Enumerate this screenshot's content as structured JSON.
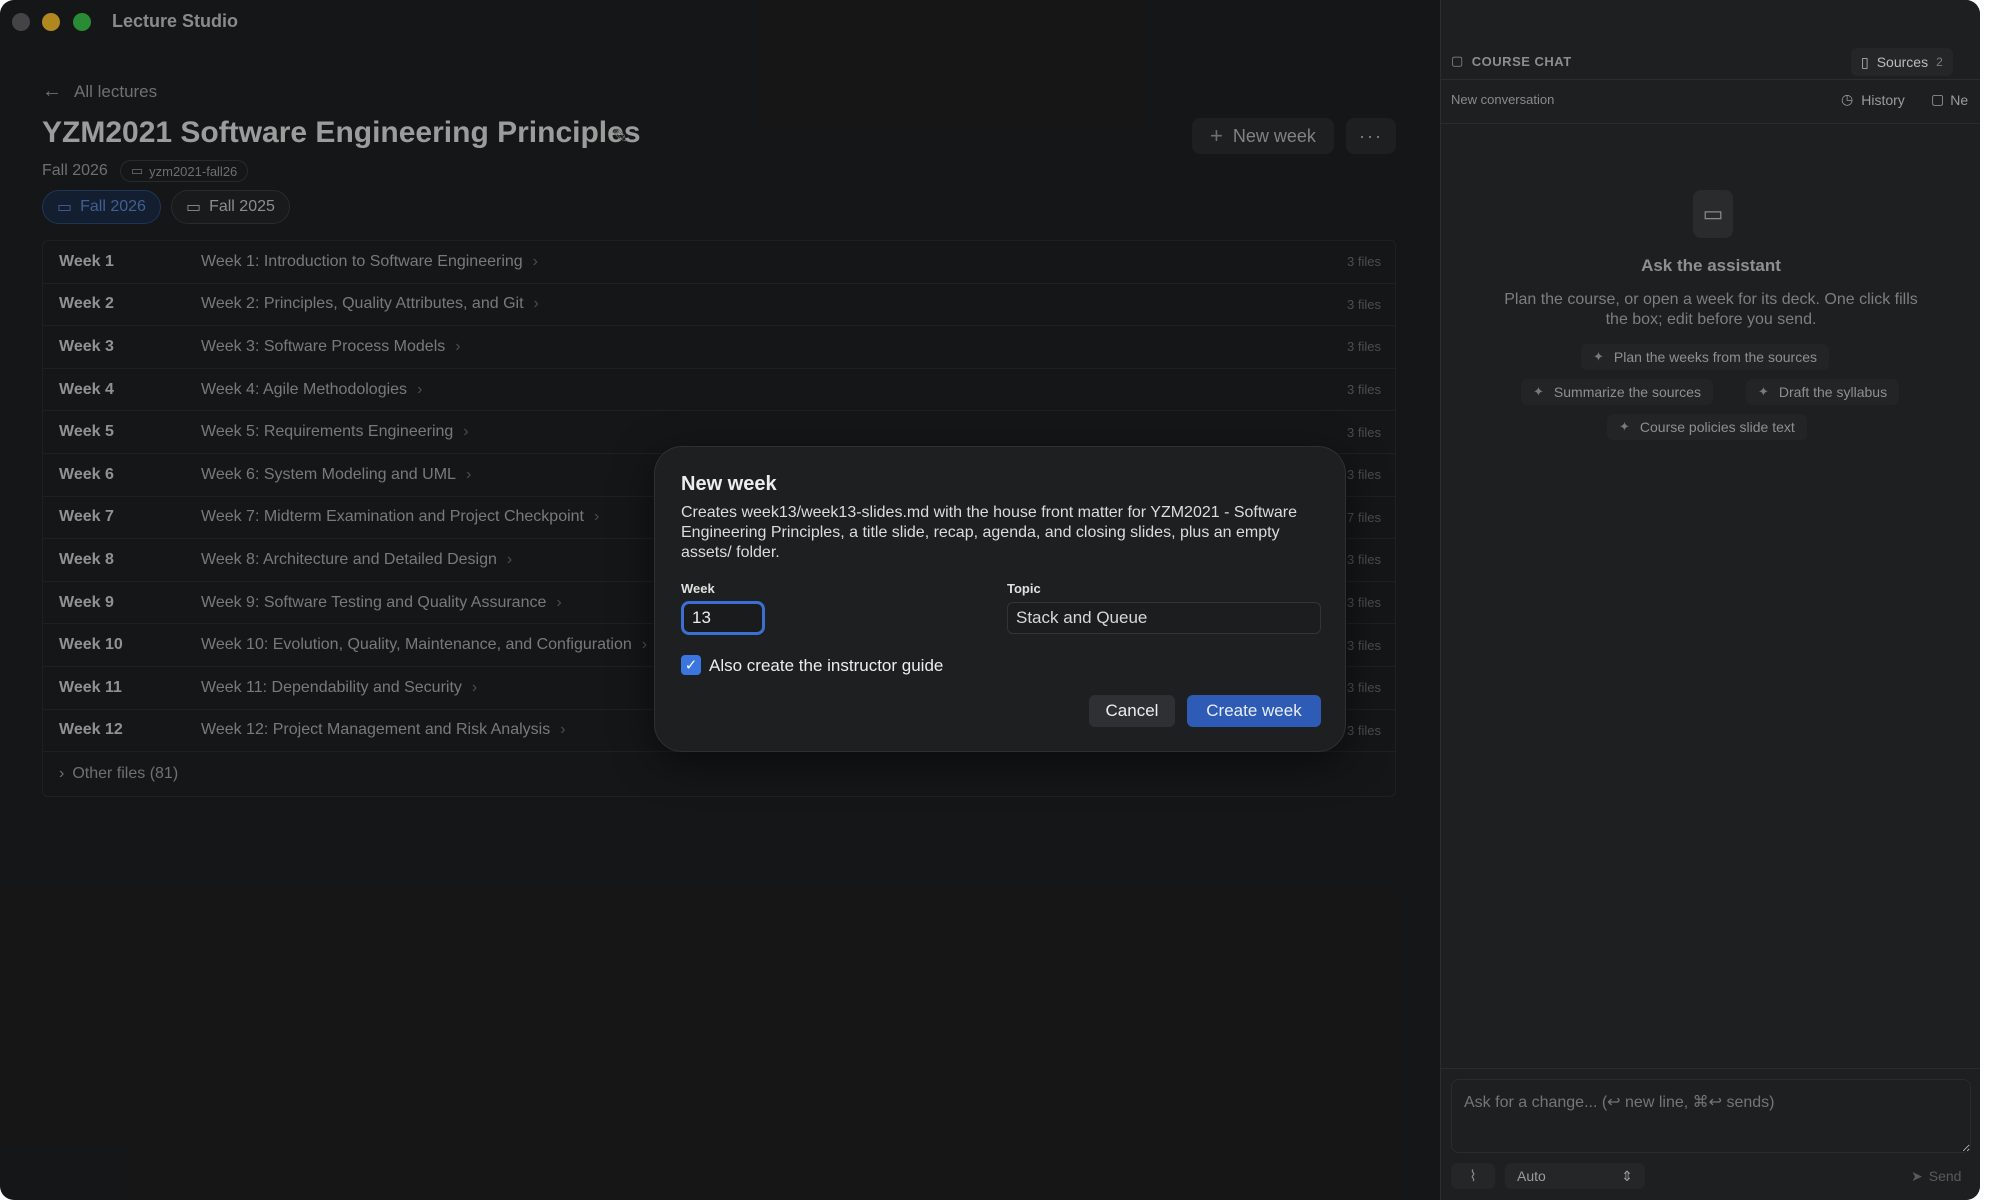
{
  "app": {
    "title": "Lecture Studio"
  },
  "nav": {
    "back_label": "All lectures"
  },
  "course": {
    "title": "YZM2021 Software Engineering Principles",
    "term": "Fall 2026",
    "repo": "yzm2021-fall26",
    "new_week_label": "New week",
    "more_label": "···"
  },
  "terms": [
    {
      "label": "Fall 2026",
      "active": true
    },
    {
      "label": "Fall 2025",
      "active": false
    }
  ],
  "weeks": [
    {
      "week": "Week 1",
      "title": "Week 1: Introduction to Software Engineering",
      "files": "3 files"
    },
    {
      "week": "Week 2",
      "title": "Week 2: Principles, Quality Attributes, and Git",
      "files": "3 files"
    },
    {
      "week": "Week 3",
      "title": "Week 3: Software Process Models",
      "files": "3 files"
    },
    {
      "week": "Week 4",
      "title": "Week 4: Agile Methodologies",
      "files": "3 files"
    },
    {
      "week": "Week 5",
      "title": "Week 5: Requirements Engineering",
      "files": "3 files"
    },
    {
      "week": "Week 6",
      "title": "Week 6: System Modeling and UML",
      "files": "3 files"
    },
    {
      "week": "Week 7",
      "title": "Week 7: Midterm Examination and Project Checkpoint",
      "files": "7 files"
    },
    {
      "week": "Week 8",
      "title": "Week 8: Architecture and Detailed Design",
      "files": "3 files"
    },
    {
      "week": "Week 9",
      "title": "Week 9: Software Testing and Quality Assurance",
      "files": "3 files"
    },
    {
      "week": "Week 10",
      "title": "Week 10: Evolution, Quality, Maintenance, and Configuration",
      "files": "3 files"
    },
    {
      "week": "Week 11",
      "title": "Week 11: Dependability and Security",
      "files": "3 files"
    },
    {
      "week": "Week 12",
      "title": "Week 12: Project Management and Risk Analysis",
      "files": "3 files"
    }
  ],
  "other_files": "Other files (81)",
  "modal": {
    "title": "New week",
    "description": "Creates week13/week13-slides.md with the house front matter for YZM2021 - Software Engineering Principles, a title slide, recap, agenda, and closing slides, plus an empty assets/ folder.",
    "week_label": "Week",
    "week_value": "13",
    "topic_label": "Topic",
    "topic_value": "Stack and Queue",
    "checkbox_label": "Also create the instructor guide",
    "checkbox_checked": true,
    "cancel_label": "Cancel",
    "create_label": "Create week"
  },
  "chat": {
    "header": "COURSE CHAT",
    "sources_label": "Sources",
    "sources_count": "2",
    "new_conversation": "New conversation",
    "history_label": "History",
    "new_label": "Ne",
    "assistant_title": "Ask the assistant",
    "assistant_desc": "Plan the course, or open a week for its deck. One click fills the box; edit before you send.",
    "suggestions": [
      "Plan the weeks from the sources",
      "Summarize the sources",
      "Draft the syllabus",
      "Course policies slide text"
    ],
    "input_placeholder": "Ask for a change... (↩ new line, ⌘↩ sends)",
    "model": "Auto",
    "send_label": "Send"
  },
  "colors": {
    "accent": "#3b6fd1",
    "primary_button": "#2d5bb6",
    "background": "#1e1f20"
  }
}
